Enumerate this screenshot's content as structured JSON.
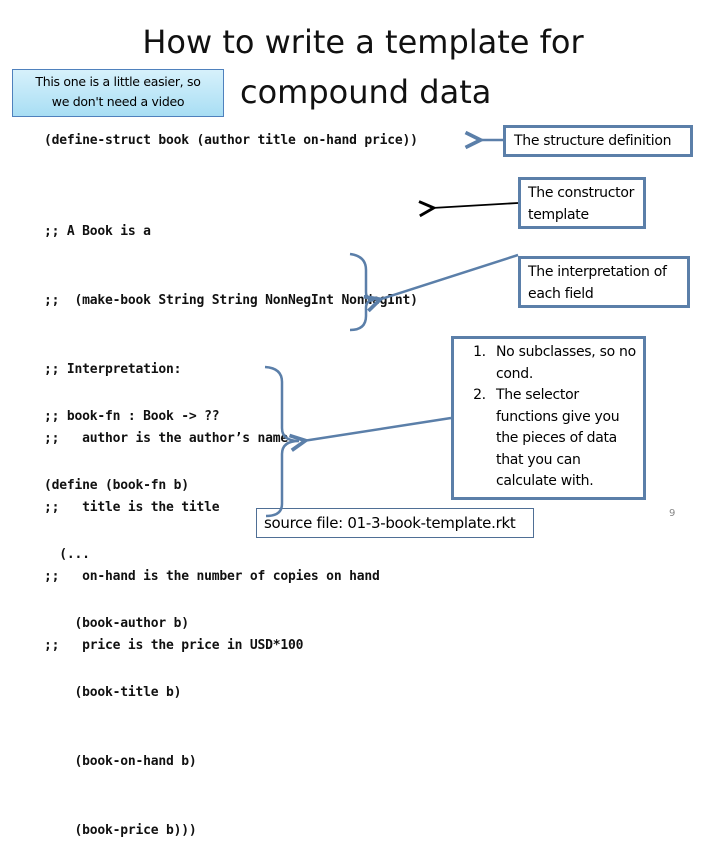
{
  "slide": {
    "title_line_1": "How to write a template for",
    "title_line_2": "compound data",
    "page_number": "9"
  },
  "note": {
    "line_1": "This one is a little easier, so",
    "line_2": "we don't need a video"
  },
  "code": {
    "struct_definition": "(define-struct book (author title on-hand price))",
    "data_definition": [
      ";; A Book is a",
      ";;  (make-book String String NonNegInt NonNegInt)",
      ";; Interpretation:",
      ";;   author is the author’s name",
      ";;   title is the title",
      ";;   on-hand is the number of copies on hand",
      ";;   price is the price in USD*100"
    ],
    "function_template": [
      ";; book-fn : Book -> ??",
      "(define (book-fn b)",
      "  (...",
      "    (book-author b)",
      "    (book-title b)",
      "    (book-on-hand b)",
      "    (book-price b)))"
    ]
  },
  "callouts": {
    "structure_definition": "The structure definition",
    "constructor_template": [
      "The constructor",
      "template"
    ],
    "interpretation": [
      "The interpretation of",
      "each field"
    ],
    "notes": [
      "No subclasses, so no cond.",
      "The selector functions give you the pieces of data that you can calculate with."
    ]
  },
  "source": {
    "label": "source file: ",
    "filename": "01-3-book-template.rkt"
  },
  "colors": {
    "callout_border": "#5b7fa9",
    "note_fill_top": "#d7f1fb",
    "note_fill_bottom": "#a8def4"
  }
}
